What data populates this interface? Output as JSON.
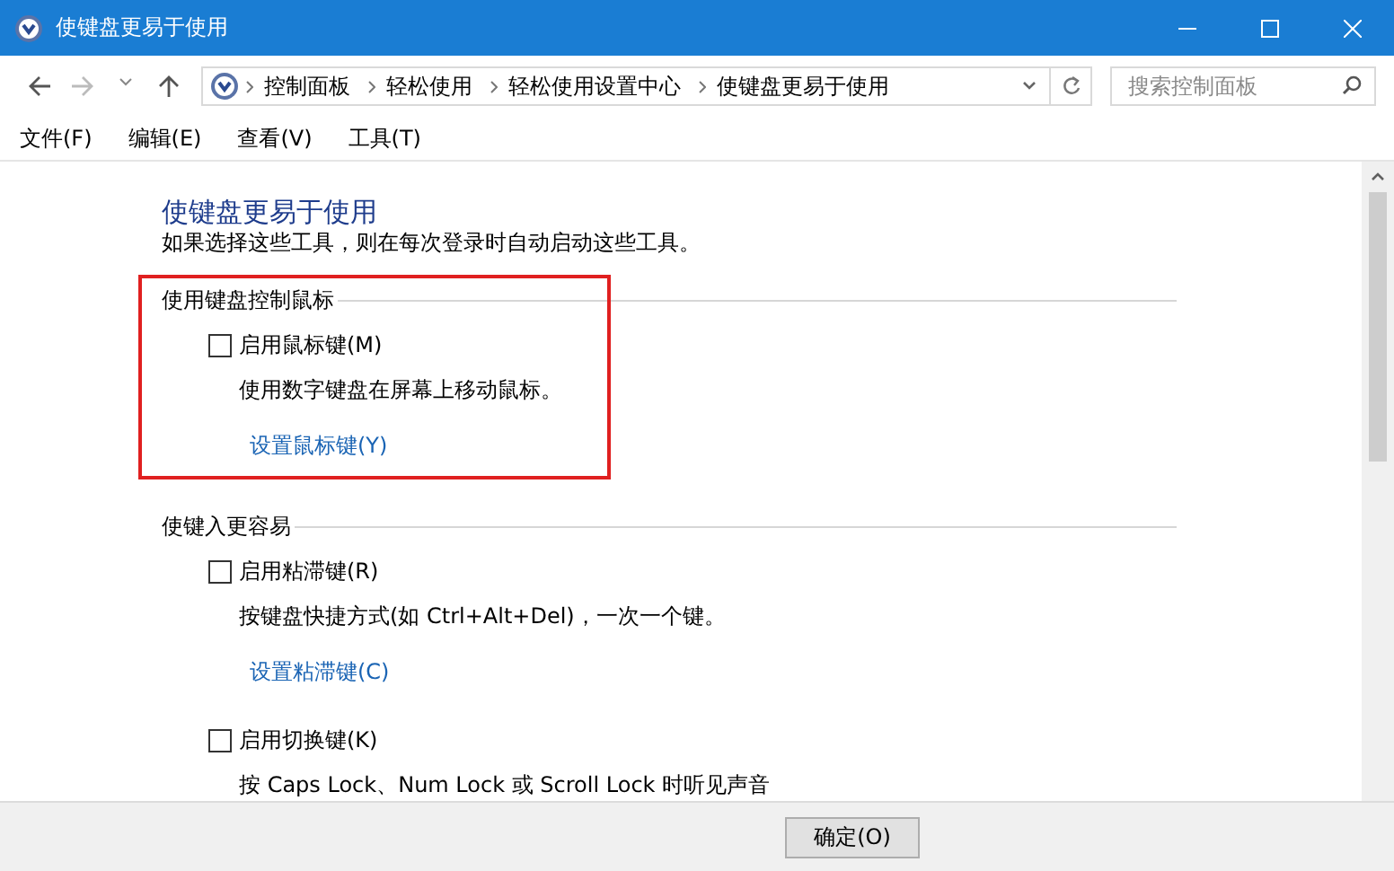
{
  "window": {
    "title": "使键盘更易于使用"
  },
  "address_bar": {
    "breadcrumbs": [
      "控制面板",
      "轻松使用",
      "轻松使用设置中心",
      "使键盘更易于使用"
    ]
  },
  "search": {
    "placeholder": "搜索控制面板"
  },
  "menu": [
    "文件(F)",
    "编辑(E)",
    "查看(V)",
    "工具(T)"
  ],
  "page": {
    "heading": "使键盘更易于使用",
    "subtitle": "如果选择这些工具，则在每次登录时自动启动这些工具。",
    "sections": [
      {
        "title": "使用键盘控制鼠标",
        "highlighted": true,
        "options": [
          {
            "label": "启用鼠标键(M)",
            "checked": false,
            "description": "使用数字键盘在屏幕上移动鼠标。",
            "link": "设置鼠标键(Y)"
          }
        ]
      },
      {
        "title": "使键入更容易",
        "highlighted": false,
        "options": [
          {
            "label": "启用粘滞键(R)",
            "checked": false,
            "description": "按键盘快捷方式(如 Ctrl+Alt+Del)，一次一个键。",
            "link": "设置粘滞键(C)"
          },
          {
            "label": "启用切换键(K)",
            "checked": false,
            "description": "按 Caps Lock、Num Lock 或 Scroll Lock 时听见声音"
          }
        ]
      }
    ]
  },
  "footer": {
    "buttons": [
      "确定(O)"
    ]
  }
}
